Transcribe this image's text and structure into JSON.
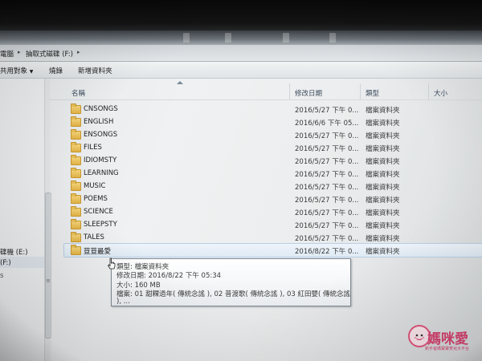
{
  "address": {
    "crumbs": [
      "電腦",
      "抽取式磁碟 (F:)"
    ]
  },
  "toolbar": {
    "share_label": "共用對象",
    "burn_label": "燒錄",
    "new_folder_label": "新增資料夾"
  },
  "nav": {
    "drive_e": "碟機 (E:)",
    "drive_f": "(F:)"
  },
  "columns": {
    "name": "名稱",
    "date": "修改日期",
    "type": "類型",
    "size": "大小"
  },
  "files": [
    {
      "name": "CNSONGS",
      "date": "2016/5/27 下午 0...",
      "type": "檔案資料夾"
    },
    {
      "name": "ENGLISH",
      "date": "2016/6/6 下午 05...",
      "type": "檔案資料夾"
    },
    {
      "name": "ENSONGS",
      "date": "2016/5/27 下午 0...",
      "type": "檔案資料夾"
    },
    {
      "name": "FILES",
      "date": "2016/5/27 下午 0...",
      "type": "檔案資料夾"
    },
    {
      "name": "IDIOMSTY",
      "date": "2016/5/27 下午 0...",
      "type": "檔案資料夾"
    },
    {
      "name": "LEARNING",
      "date": "2016/5/27 下午 0...",
      "type": "檔案資料夾"
    },
    {
      "name": "MUSIC",
      "date": "2016/5/27 下午 0...",
      "type": "檔案資料夾"
    },
    {
      "name": "POEMS",
      "date": "2016/5/27 下午 0...",
      "type": "檔案資料夾"
    },
    {
      "name": "SCIENCE",
      "date": "2016/5/27 下午 0...",
      "type": "檔案資料夾"
    },
    {
      "name": "SLEEPSTY",
      "date": "2016/5/27 下午 0...",
      "type": "檔案資料夾"
    },
    {
      "name": "TALES",
      "date": "2016/5/27 下午 0...",
      "type": "檔案資料夾"
    },
    {
      "name": "荳荳最愛",
      "date": "2016/8/22 下午 0...",
      "type": "檔案資料夾"
    }
  ],
  "tooltip": {
    "type_line": "類型: 檔案資料夾",
    "date_line": "修改日期: 2016/8/22 下午 05:34",
    "size_line": "大小: 160 MB",
    "files_line": "檔案: 01 甜粿過年( 傳統念謠 ), 02 普渡歌( 傳統念謠 ), 03 紅田嬰( 傳統念謠",
    "files_more": "), ..."
  },
  "watermark": {
    "brand": "媽咪愛",
    "tagline": "新手爸媽寶寶育兒大平台"
  },
  "colors": {
    "folder": "#e4b447",
    "hover_row": "#dfeaf4",
    "header_text": "#3a4a5c"
  }
}
